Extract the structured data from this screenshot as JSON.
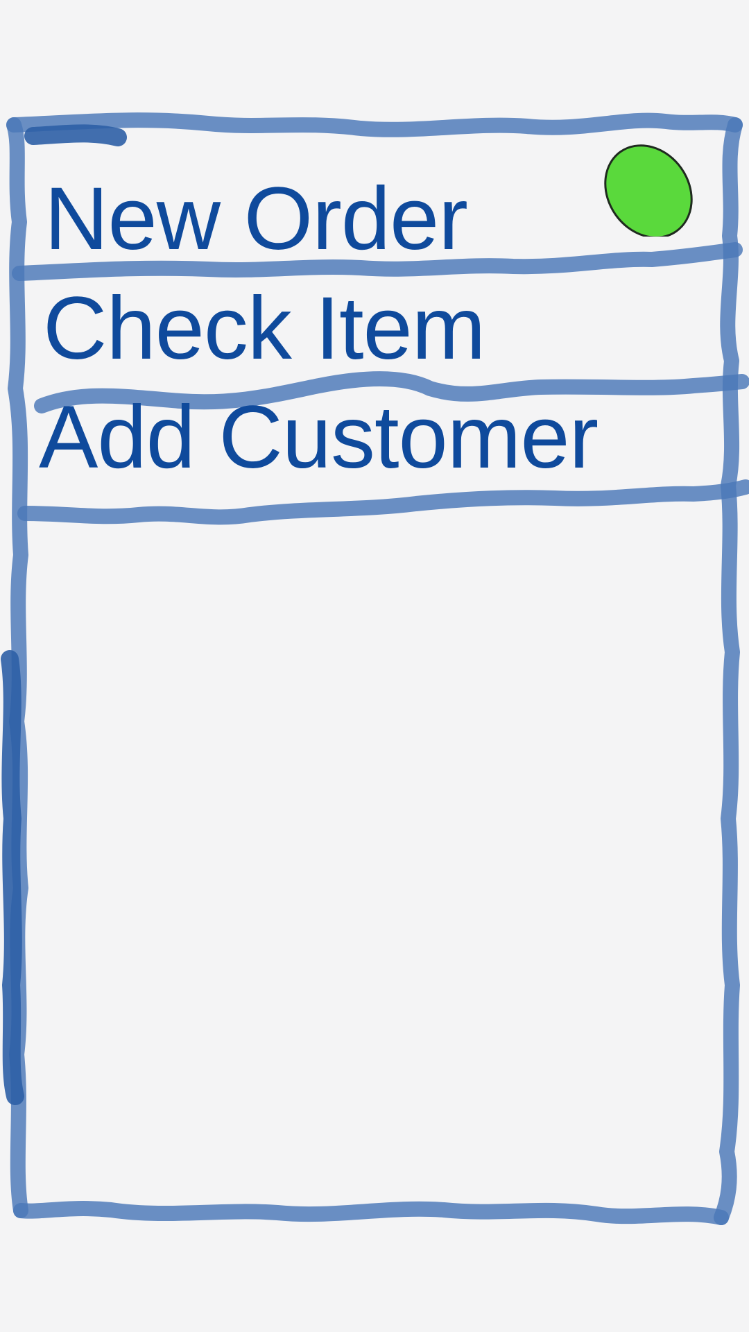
{
  "menu": {
    "items": [
      {
        "label": "New Order"
      },
      {
        "label": "Check Item"
      },
      {
        "label": "Add Customer"
      }
    ]
  },
  "status_indicator": {
    "color": "#5ad93c",
    "outline": "#1f2a1f",
    "icon": "status-dot-icon"
  },
  "sketch": {
    "stroke_color": "#4a78b8",
    "text_color": "#0f4a9c",
    "background": "#f4f4f5"
  }
}
